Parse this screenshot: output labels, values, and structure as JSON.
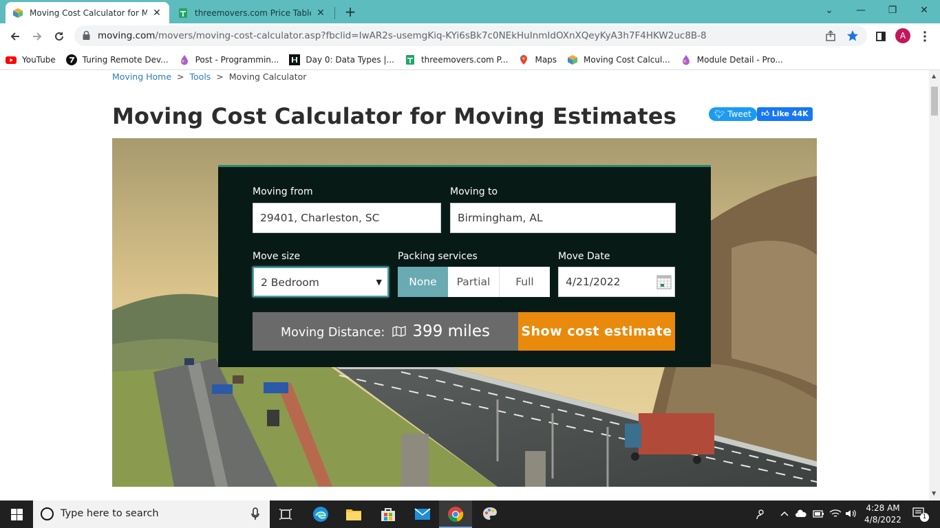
{
  "browser": {
    "tabs": [
      {
        "title": "Moving Cost Calculator for Movi",
        "active": true
      },
      {
        "title": "threemovers.com Price Table - Go",
        "active": false
      }
    ],
    "new_tab_label": "+",
    "window_controls": {
      "minimize": "⌄",
      "restore": "—",
      "maximize": "❐",
      "close": "✕"
    },
    "url_host": "moving.com",
    "url_path": "/movers/moving-cost-calculator.asp?fbclid=IwAR2s-usemgKiq-KYi6sBk7c0NEkHuInmIdOXnXQeyKyA3h7F4HKW2uc8B-8",
    "profile_initial": "A",
    "bookmarks": [
      "YouTube",
      "Turing Remote Dev...",
      "Post - Programmin...",
      "Day 0: Data Types |...",
      "threemovers.com P...",
      "Maps",
      "Moving Cost Calcul...",
      "Module Detail - Pro..."
    ]
  },
  "page": {
    "breadcrumb": {
      "home": "Moving Home",
      "tools": "Tools",
      "current": "Moving Calculator",
      "sep": ">"
    },
    "title": "Moving Cost Calculator for Moving Estimates",
    "social": {
      "tweet": "Tweet",
      "like": "Like 44K"
    },
    "calculator": {
      "moving_from_label": "Moving from",
      "moving_from_value": "29401, Charleston, SC",
      "moving_to_label": "Moving to",
      "moving_to_value": "Birmingham, AL",
      "move_size_label": "Move size",
      "move_size_value": "2 Bedroom",
      "packing_label": "Packing services",
      "packing_options": [
        "None",
        "Partial",
        "Full"
      ],
      "packing_selected": "None",
      "move_date_label": "Move Date",
      "move_date_value": "4/21/2022",
      "distance_label": "Moving Distance:",
      "distance_value": "399 miles",
      "estimate_button": "Show cost estimate"
    }
  },
  "taskbar": {
    "search_placeholder": "Type here to search",
    "time": "4:28 AM",
    "date": "4/8/2022",
    "notification_count": "1"
  },
  "colors": {
    "chrome_tab_strip": "#5dbcbe",
    "calculator_bg": "#081a16",
    "packing_selected": "#6aaab3",
    "estimate_button": "#e98a0c",
    "distance_bar": "#6a6a6a"
  }
}
